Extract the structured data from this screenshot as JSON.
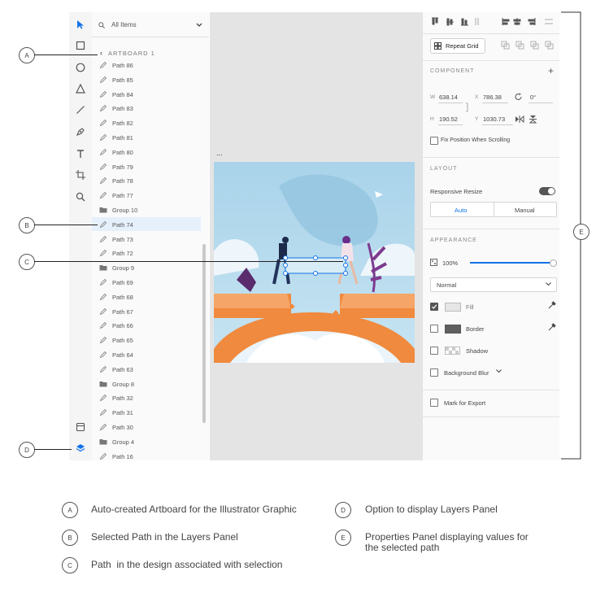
{
  "layers_panel": {
    "search_placeholder": "All Items",
    "artboard_label": "ARTBOARD 1",
    "rows": [
      {
        "label": "Path 86",
        "type": "path"
      },
      {
        "label": "Path 85",
        "type": "path"
      },
      {
        "label": "Path 84",
        "type": "path"
      },
      {
        "label": "Path 83",
        "type": "path"
      },
      {
        "label": "Path 82",
        "type": "path"
      },
      {
        "label": "Path 81",
        "type": "path"
      },
      {
        "label": "Path 80",
        "type": "path"
      },
      {
        "label": "Path 79",
        "type": "path"
      },
      {
        "label": "Path 78",
        "type": "path"
      },
      {
        "label": "Path 77",
        "type": "path"
      },
      {
        "label": "Group 10",
        "type": "group"
      },
      {
        "label": "Path 74",
        "type": "path",
        "selected": true
      },
      {
        "label": "Path 73",
        "type": "path"
      },
      {
        "label": "Path 72",
        "type": "path"
      },
      {
        "label": "Group 9",
        "type": "group"
      },
      {
        "label": "Path 69",
        "type": "path"
      },
      {
        "label": "Path 68",
        "type": "path"
      },
      {
        "label": "Path 67",
        "type": "path"
      },
      {
        "label": "Path 66",
        "type": "path"
      },
      {
        "label": "Path 65",
        "type": "path"
      },
      {
        "label": "Path 64",
        "type": "path"
      },
      {
        "label": "Path 63",
        "type": "path"
      },
      {
        "label": "Group 8",
        "type": "group"
      },
      {
        "label": "Path 32",
        "type": "path"
      },
      {
        "label": "Path 31",
        "type": "path"
      },
      {
        "label": "Path 30",
        "type": "path"
      },
      {
        "label": "Group 4",
        "type": "group"
      },
      {
        "label": "Path 16",
        "type": "path"
      }
    ]
  },
  "canvas": {
    "artboard_ellipsis": "..."
  },
  "properties": {
    "repeat_grid": "Repeat Grid",
    "component_title": "COMPONENT",
    "component_add": "+",
    "w_label": "W",
    "w_value": "638.14",
    "x_label": "X",
    "x_value": "786.38",
    "rotation_value": "0°",
    "h_label": "H",
    "h_value": "190.52",
    "y_label": "Y",
    "y_value": "1030.73",
    "fix_position": "Fix Position When Scrolling",
    "layout_title": "LAYOUT",
    "responsive_resize": "Responsive Resize",
    "responsive_on": true,
    "auto_label": "Auto",
    "manual_label": "Manual",
    "appearance_title": "APPEARANCE",
    "opacity": "100%",
    "opacity_fraction": 1.0,
    "blend_mode": "Normal",
    "fill_label": "Fill",
    "fill_checked": true,
    "border_label": "Border",
    "shadow_label": "Shadow",
    "background_blur": "Background Blur",
    "mark_export": "Mark for Export"
  },
  "callouts": [
    "A",
    "B",
    "C",
    "D",
    "E"
  ],
  "legend": [
    {
      "letter": "A",
      "text": "Auto-created Artboard for the Illustrator Graphic"
    },
    {
      "letter": "B",
      "text": "Selected Path in the Layers Panel"
    },
    {
      "letter": "C",
      "text": "Path  in the design associated with selection"
    },
    {
      "letter": "D",
      "text": "Option to display Layers Panel"
    },
    {
      "letter": "E",
      "text": "Properties Panel displaying values for the selected path"
    }
  ],
  "colors": {
    "accent": "#1473e6",
    "sky": "#a9d3ea",
    "orange": "#f08a3e",
    "selection_row": "#e6f0fb"
  }
}
